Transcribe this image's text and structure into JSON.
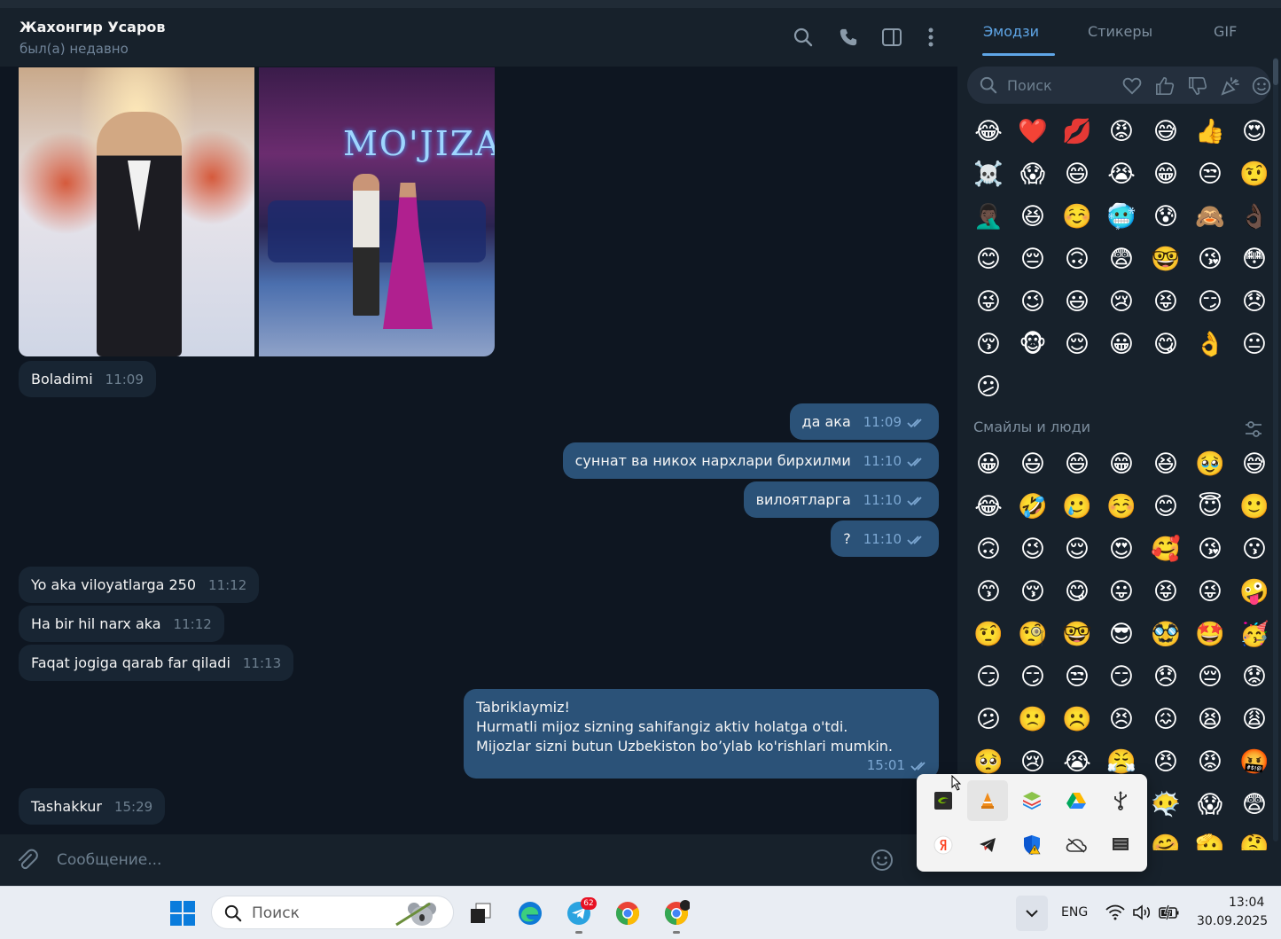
{
  "chat": {
    "name": "Жахонгир Усаров",
    "status": "был(а) недавно",
    "photo_logo_text": "MO'JIZA",
    "messages": [
      {
        "dir": "in",
        "text": "Boladimi",
        "time": "11:09"
      },
      {
        "dir": "out",
        "text": "да ака",
        "time": "11:09"
      },
      {
        "dir": "out",
        "text": "суннат ва никох нархлари бирхилми",
        "time": "11:10"
      },
      {
        "dir": "out",
        "text": "вилоятларга",
        "time": "11:10"
      },
      {
        "dir": "out",
        "text": "?",
        "time": "11:10"
      },
      {
        "dir": "in",
        "text": "Yo aka viloyatlarga 250",
        "time": "11:12"
      },
      {
        "dir": "in",
        "text": "Ha bir hil narx aka",
        "time": "11:12"
      },
      {
        "dir": "in",
        "text": "Faqat jogiga qarab far qiladi",
        "time": "11:13"
      },
      {
        "dir": "out",
        "lines": [
          "Tabriklaymiz!",
          "Hurmatli mijoz sizning sahifangiz aktiv holatga o'tdi.",
          "Mijozlar sizni butun Uzbekiston bo’ylab ko'rishlari mumkin."
        ],
        "time": "15:01"
      },
      {
        "dir": "in",
        "text": "Tashakkur",
        "time": "15:29"
      }
    ],
    "composer_placeholder": "Сообщение..."
  },
  "panel": {
    "tabs": [
      "Эмодзи",
      "Стикеры",
      "GIF"
    ],
    "active_tab": "Эмодзи",
    "search_placeholder": "Поиск",
    "recent": [
      "😂",
      "❤️",
      "💋",
      "😡",
      "😅",
      "👍",
      "😍",
      "☠️",
      "😱",
      "😄",
      "😭",
      "😁",
      "😒",
      "🤨",
      "🤦🏿‍♂️",
      "😆",
      "☺️",
      "🥶",
      "😰",
      "🙈",
      "👌🏿",
      "😊",
      "😔",
      "🙃",
      "😨",
      "🤓",
      "😘",
      "😳",
      "😜",
      "😉",
      "😃",
      "😢",
      "😝",
      "😏",
      "😞",
      "😚",
      "🐵",
      "😌",
      "😀",
      "😋",
      "👌",
      "😐",
      "😕"
    ],
    "section_title": "Смайлы и люди",
    "smileys": [
      "😀",
      "😃",
      "😄",
      "😁",
      "😆",
      "🥹",
      "😅",
      "😂",
      "🤣",
      "🥲",
      "☺️",
      "😊",
      "😇",
      "🙂",
      "🙃",
      "😉",
      "😌",
      "😍",
      "🥰",
      "😘",
      "😗",
      "😙",
      "😚",
      "😋",
      "😛",
      "😝",
      "😜",
      "🤪",
      "🤨",
      "🧐",
      "🤓",
      "😎",
      "🥸",
      "🤩",
      "🥳",
      "😏",
      "😏",
      "😒",
      "😏",
      "😞",
      "😔",
      "😟",
      "😕",
      "🙁",
      "☹️",
      "😣",
      "😖",
      "😫",
      "😩",
      "🥺",
      "😢",
      "😭",
      "😤",
      "😠",
      "😡",
      "🤬",
      "🤯",
      "😳",
      "🥵",
      "🥶",
      "😶‍🌫️",
      "😱",
      "😨",
      "😰",
      "😥",
      "😓",
      "🫣",
      "🤗",
      "🫡",
      "🤔"
    ]
  },
  "tray": {
    "icons": [
      "nvidia-icon",
      "vlc-icon",
      "bluestacks-icon",
      "google-drive-icon",
      "usb-icon",
      "yandex-icon",
      "telegram-icon",
      "defender-warning-icon",
      "onedrive-off-icon",
      "display-icon"
    ]
  },
  "taskbar": {
    "search_placeholder": "Поиск",
    "telegram_badge": "62",
    "language": "ENG",
    "time": "13:04",
    "date": "30.09.2025"
  }
}
